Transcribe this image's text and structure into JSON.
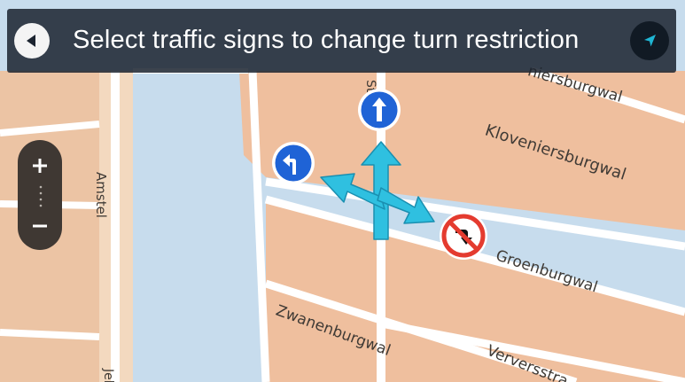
{
  "header": {
    "title": "Select traffic signs to change turn restriction",
    "back_icon": "back-arrow-icon",
    "nav_icon": "current-location-arrow-icon"
  },
  "map": {
    "streets": [
      "niersburgwal",
      "Kloveniersburgwal",
      "Amstel",
      "Groenburgwal",
      "Zwanenburgwal",
      "Verversstra",
      "Staal",
      "Jel"
    ]
  },
  "zoom": {
    "zoom_in_icon": "plus-icon",
    "zoom_out_icon": "minus-icon"
  },
  "signs": [
    {
      "name": "straight-ahead",
      "icon": "straight-arrow-icon",
      "state": "allowed",
      "color": "#1f63d6"
    },
    {
      "name": "left-turn",
      "icon": "left-turn-arrow-icon",
      "state": "allowed",
      "color": "#1f63d6"
    },
    {
      "name": "right-turn",
      "icon": "no-right-turn-icon",
      "state": "restricted",
      "color": "#e43b2f"
    }
  ],
  "colors": {
    "water": "#c7dced",
    "block": "#efbf9e",
    "road": "#ffffff",
    "header": "#1c2430",
    "arrow": "#2fc0e0",
    "sign_blue": "#1f63d6",
    "sign_red": "#e43b2f",
    "accent": "#1fb6d4"
  }
}
